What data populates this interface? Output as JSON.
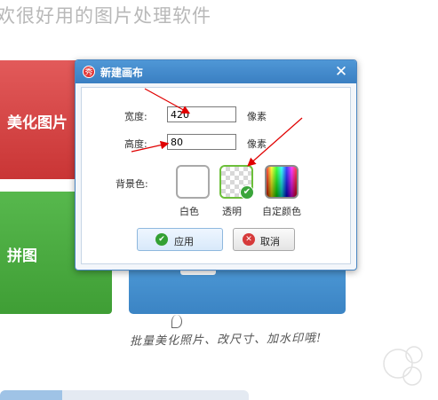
{
  "background": {
    "headline": "欢很好用的图片处理软件",
    "tiles": {
      "beautify": "美化图片",
      "collage": "拼图"
    },
    "handnote": "批量美化照片、改尺寸、加水印哦!"
  },
  "dialog": {
    "title": "新建画布",
    "logo_glyph": "秀",
    "close_glyph": "✕",
    "width_label": "宽度:",
    "width_value": "420",
    "width_unit": "像素",
    "height_label": "高度:",
    "height_value": "80",
    "height_unit": "像素",
    "bg_label": "背景色:",
    "swatches": {
      "white": "白色",
      "transparent": "透明",
      "custom": "自定颜色"
    },
    "selected_swatch": "transparent",
    "ok_label": "应用",
    "cancel_label": "取消"
  },
  "colors": {
    "titlebar": "#3a7fc2",
    "annotation_arrow": "#e00000",
    "selected_border": "#6cbf3a"
  }
}
